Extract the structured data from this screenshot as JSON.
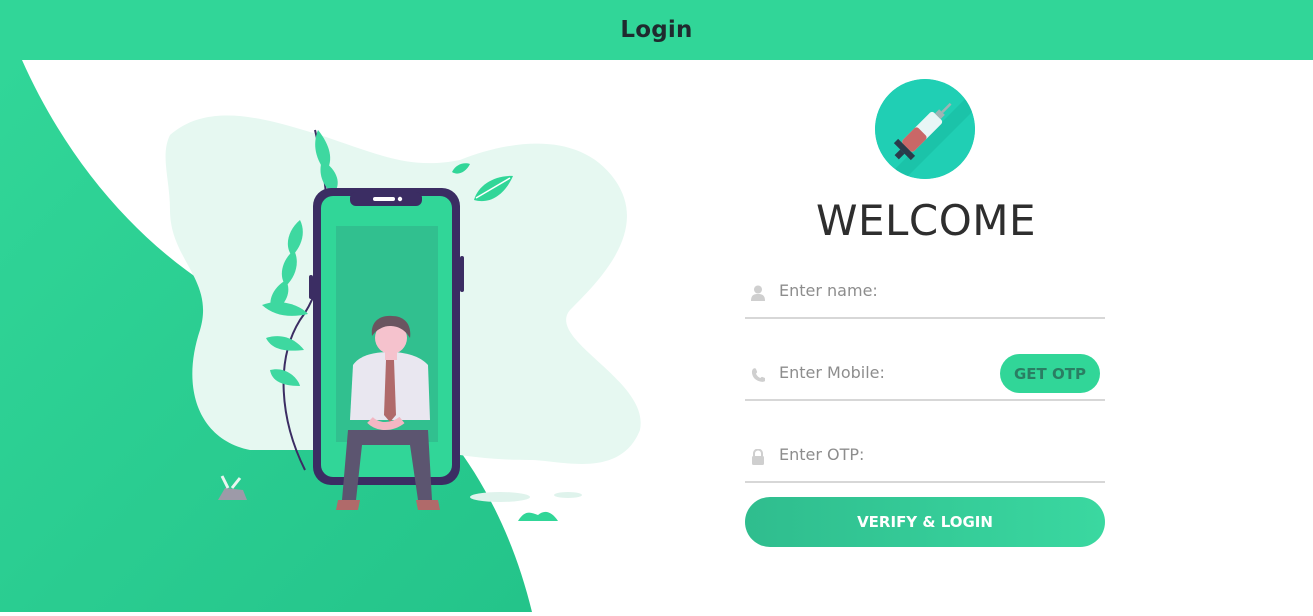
{
  "header": {
    "title": "Login"
  },
  "logo": {
    "icon": "syringe-icon"
  },
  "main": {
    "welcome": "WELCOME"
  },
  "form": {
    "name": {
      "placeholder": "Enter name:",
      "icon": "user-icon"
    },
    "mobile": {
      "placeholder": "Enter Mobile:",
      "icon": "phone-icon"
    },
    "otp": {
      "placeholder": "Enter OTP:",
      "icon": "lock-icon"
    },
    "get_otp_label": "GET OTP",
    "submit_label": "VERIFY & LOGIN"
  },
  "colors": {
    "accent": "#31d698",
    "accent_dark": "#2fbd8e",
    "phone_frame": "#3b2d63",
    "logo_bg": "#20cfb4",
    "text_dark": "#2e2e2e"
  }
}
